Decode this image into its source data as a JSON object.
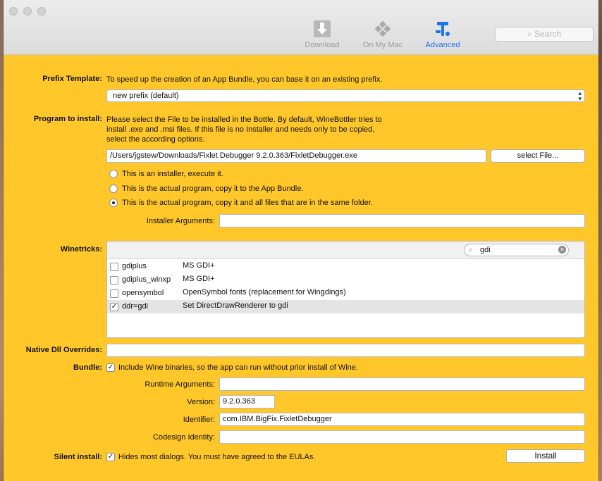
{
  "toolbar": {
    "download_label": "Download",
    "on_my_mac_label": "On My Mac",
    "advanced_label": "Advanced",
    "search_placeholder": "Search",
    "accent_color": "#1a73e8"
  },
  "prefix": {
    "label": "Prefix Template:",
    "description": "To speed up the creation of an App Bundle, you can base it on an existing prefix.",
    "selected": "new prefix (default)"
  },
  "program": {
    "label": "Program to install:",
    "description_line1": "Please select the File to be installed in the Bottle. By default, WineBottler tries to",
    "description_line2": "install .exe and .msi files. If this file is no Installer and needs only to be copied,",
    "description_line3": "select the according options.",
    "path": "/Users/jgstew/Downloads/Fixlet Debugger 9.2.0.363/FixletDebugger.exe",
    "select_file_label": "select File...",
    "options": [
      {
        "label": "This is an installer, execute it.",
        "selected": false
      },
      {
        "label": "This is the actual program, copy it to the App Bundle.",
        "selected": false
      },
      {
        "label": "This is the actual program, copy it and all files that are in the same folder.",
        "selected": true
      }
    ],
    "installer_args_label": "Installer Arguments:",
    "installer_args_value": ""
  },
  "winetricks": {
    "label": "Winetricks:",
    "search_value": "gdi",
    "items": [
      {
        "name": "gdiplus",
        "description": "MS GDI+",
        "checked": false
      },
      {
        "name": "gdiplus_winxp",
        "description": "MS GDI+",
        "checked": false
      },
      {
        "name": "opensymbol",
        "description": "OpenSymbol fonts (replacement for Wingdings)",
        "checked": false
      },
      {
        "name": "ddr=gdi",
        "description": "Set DirectDrawRenderer to gdi",
        "checked": true
      }
    ]
  },
  "native_dll": {
    "label": "Native Dll Overrides:",
    "value": ""
  },
  "bundle": {
    "label": "Bundle:",
    "include_wine_label": "Include Wine binaries, so the app can run without prior install of Wine.",
    "include_wine_checked": true,
    "runtime_args_label": "Runtime Arguments:",
    "runtime_args_value": "",
    "version_label": "Version:",
    "version_value": "9.2.0.363",
    "identifier_label": "Identifier:",
    "identifier_value": "com.IBM.BigFix.FixletDebugger",
    "codesign_label": "Codesign Identity:",
    "codesign_value": ""
  },
  "silent": {
    "label": "Silent install:",
    "description": "Hides most dialogs. You must have agreed to the EULAs.",
    "checked": true,
    "install_label": "Install"
  }
}
